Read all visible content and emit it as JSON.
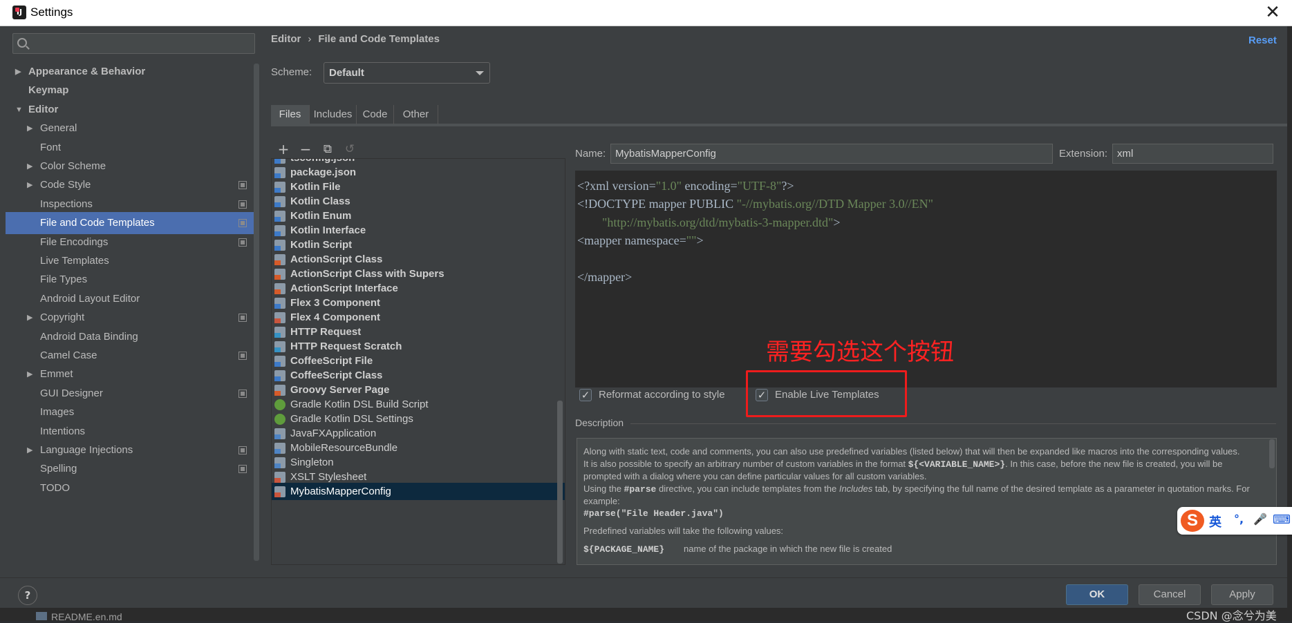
{
  "window": {
    "title": "Settings",
    "close_glyph": "✕"
  },
  "search": {
    "placeholder": "",
    "icon": "search-icon"
  },
  "tree": [
    {
      "label": "Appearance & Behavior",
      "arrow": "▶",
      "indent": 0,
      "bold": true
    },
    {
      "label": "Keymap",
      "arrow": "",
      "indent": 0,
      "bold": true
    },
    {
      "label": "Editor",
      "arrow": "▼",
      "indent": 0,
      "bold": true
    },
    {
      "label": "General",
      "arrow": "▶",
      "indent": 1
    },
    {
      "label": "Font",
      "arrow": "",
      "indent": 1
    },
    {
      "label": "Color Scheme",
      "arrow": "▶",
      "indent": 1
    },
    {
      "label": "Code Style",
      "arrow": "▶",
      "indent": 1,
      "project": true
    },
    {
      "label": "Inspections",
      "arrow": "",
      "indent": 1,
      "project": true
    },
    {
      "label": "File and Code Templates",
      "arrow": "",
      "indent": 1,
      "project": true,
      "selected": true
    },
    {
      "label": "File Encodings",
      "arrow": "",
      "indent": 1,
      "project": true
    },
    {
      "label": "Live Templates",
      "arrow": "",
      "indent": 1
    },
    {
      "label": "File Types",
      "arrow": "",
      "indent": 1
    },
    {
      "label": "Android Layout Editor",
      "arrow": "",
      "indent": 1
    },
    {
      "label": "Copyright",
      "arrow": "▶",
      "indent": 1,
      "project": true
    },
    {
      "label": "Android Data Binding",
      "arrow": "",
      "indent": 1
    },
    {
      "label": "Camel Case",
      "arrow": "",
      "indent": 1,
      "project": true
    },
    {
      "label": "Emmet",
      "arrow": "▶",
      "indent": 1
    },
    {
      "label": "GUI Designer",
      "arrow": "",
      "indent": 1,
      "project": true
    },
    {
      "label": "Images",
      "arrow": "",
      "indent": 1
    },
    {
      "label": "Intentions",
      "arrow": "",
      "indent": 1
    },
    {
      "label": "Language Injections",
      "arrow": "▶",
      "indent": 1,
      "project": true
    },
    {
      "label": "Spelling",
      "arrow": "",
      "indent": 1,
      "project": true
    },
    {
      "label": "TODO",
      "arrow": "",
      "indent": 1
    }
  ],
  "breadcrumb": {
    "parent": "Editor",
    "separator": "›",
    "current": "File and Code Templates"
  },
  "reset_label": "Reset",
  "scheme": {
    "label": "Scheme:",
    "value": "Default"
  },
  "tabs": [
    {
      "label": "Files",
      "active": true
    },
    {
      "label": "Includes"
    },
    {
      "label": "Code"
    },
    {
      "label": "Other"
    }
  ],
  "toolbar": {
    "add": "+",
    "remove": "−",
    "copy": "⧉",
    "reset": "↺"
  },
  "templates": [
    {
      "label": "tsconfig.json",
      "bold": true,
      "icon": "f"
    },
    {
      "label": "package.json",
      "bold": true,
      "icon": "f"
    },
    {
      "label": "Kotlin File",
      "bold": true,
      "icon": "f"
    },
    {
      "label": "Kotlin Class",
      "bold": true,
      "icon": "f"
    },
    {
      "label": "Kotlin Enum",
      "bold": true,
      "icon": "f"
    },
    {
      "label": "Kotlin Interface",
      "bold": true,
      "icon": "f"
    },
    {
      "label": "Kotlin Script",
      "bold": true,
      "icon": "f"
    },
    {
      "label": "ActionScript Class",
      "bold": true,
      "icon": "as"
    },
    {
      "label": "ActionScript Class with Supers",
      "bold": true,
      "icon": "as"
    },
    {
      "label": "ActionScript Interface",
      "bold": true,
      "icon": "as"
    },
    {
      "label": "Flex 3 Component",
      "bold": true,
      "icon": "f"
    },
    {
      "label": "Flex 4 Component",
      "bold": true,
      "icon": "x"
    },
    {
      "label": "HTTP Request",
      "bold": true,
      "icon": "api"
    },
    {
      "label": "HTTP Request Scratch",
      "bold": true,
      "icon": "api"
    },
    {
      "label": "CoffeeScript File",
      "bold": true,
      "icon": "f"
    },
    {
      "label": "CoffeeScript Class",
      "bold": true,
      "icon": "f"
    },
    {
      "label": "Groovy Server Page",
      "bold": true,
      "icon": "as"
    },
    {
      "label": "Gradle Kotlin DSL Build Script",
      "bold": false,
      "icon": "g"
    },
    {
      "label": "Gradle Kotlin DSL Settings",
      "bold": false,
      "icon": "g"
    },
    {
      "label": "JavaFXApplication",
      "bold": false,
      "icon": "j"
    },
    {
      "label": "MobileResourceBundle",
      "bold": false,
      "icon": "j"
    },
    {
      "label": "Singleton",
      "bold": false,
      "icon": "j"
    },
    {
      "label": "XSLT Stylesheet",
      "bold": false,
      "icon": "x"
    },
    {
      "label": "MybatisMapperConfig",
      "bold": false,
      "icon": "x",
      "selected": true
    }
  ],
  "name_field": {
    "label": "Name:",
    "value": "MybatisMapperConfig"
  },
  "extension_field": {
    "label": "Extension:",
    "value": "xml"
  },
  "code_lines": [
    [
      {
        "t": "<?xml version="
      },
      {
        "t": "\"1.0\"",
        "s": true
      },
      {
        "t": " encoding="
      },
      {
        "t": "\"UTF-8\"",
        "s": true
      },
      {
        "t": "?>"
      }
    ],
    [
      {
        "t": "<!DOCTYPE mapper PUBLIC "
      },
      {
        "t": "\"-//mybatis.org//DTD Mapper 3.0//EN\"",
        "s": true
      }
    ],
    [
      {
        "t": "        "
      },
      {
        "t": "\"http://mybatis.org/dtd/mybatis-3-mapper.dtd\"",
        "s": true
      },
      {
        "t": ">"
      }
    ],
    [
      {
        "t": "<mapper namespace="
      },
      {
        "t": "\"\"",
        "s": true
      },
      {
        "t": ">"
      }
    ],
    [
      {
        "t": ""
      }
    ],
    [
      {
        "t": "</mapper>"
      }
    ]
  ],
  "annotation": "需要勾选这个按钮",
  "reformat": {
    "label": "Reformat according to style",
    "checked": true
  },
  "live_templates": {
    "label": "Enable Live Templates",
    "checked": true
  },
  "description": {
    "title": "Description",
    "p1": "Along with static text, code and comments, you can also use predefined variables (listed below) that will then be expanded like macros into the corresponding values.",
    "p2a": "It is also possible to specify an arbitrary number of custom variables in the format ",
    "p2code": "${<VARIABLE_NAME>}",
    "p2b": ". In this case, before the new file is created, you will be prompted with a dialog where you can define particular values for all custom variables.",
    "p3a": "Using the ",
    "p3code": "#parse",
    "p3b": " directive, you can include templates from the ",
    "p3it": "Includes",
    "p3c": " tab, by specifying the full name of the desired template as a parameter in quotation marks. For example:",
    "p4code": "#parse(\"File Header.java\")",
    "p5": "Predefined variables will take the following values:",
    "p6code": "${PACKAGE_NAME}",
    "p6": "name of the package in which the new file is created"
  },
  "buttons": {
    "help": "?",
    "ok": "OK",
    "cancel": "Cancel",
    "apply": "Apply"
  },
  "background": {
    "file": "README.en.md"
  },
  "watermark": "CSDN @念兮为美",
  "ime": {
    "logo": "S",
    "lang": "英",
    "punct": "°,",
    "mic": "🎤",
    "kbd": "⌨"
  },
  "colors": {
    "accent": "#4b6eaf",
    "link": "#589df6",
    "annotation": "#ee1c1c",
    "string": "#6a8759"
  }
}
